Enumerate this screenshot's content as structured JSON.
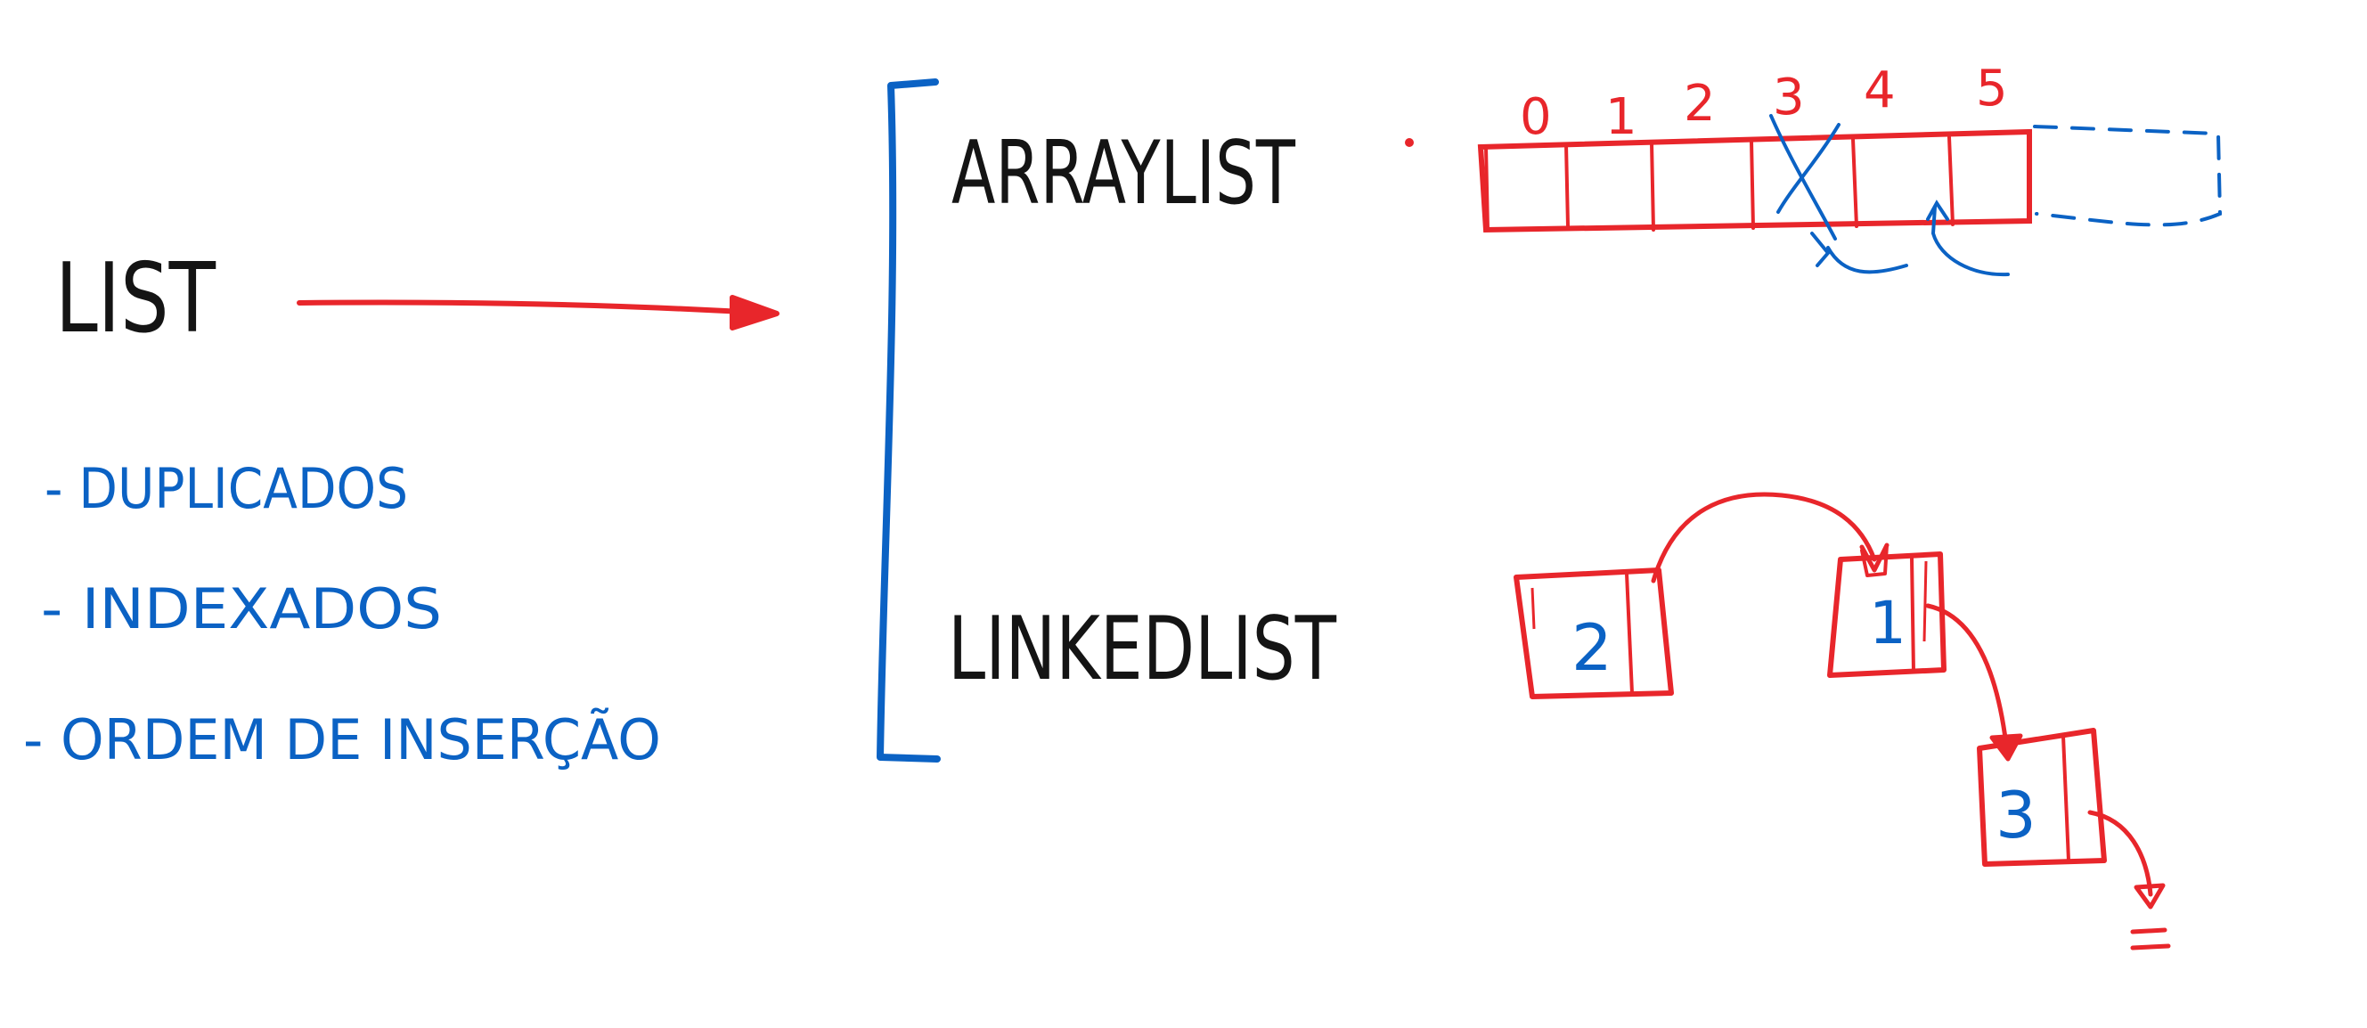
{
  "colors": {
    "black": "#141414",
    "red": "#e8262b",
    "blue": "#0b62c4"
  },
  "list_title": "LIST",
  "features": [
    "- DUPLICADOS",
    "- INDEXADOS",
    "- ORDEM DE INSERÇÃO"
  ],
  "arraylist": {
    "title": "ARRAYLIST",
    "indices": [
      "0",
      "1",
      "2",
      "3",
      "4",
      "5"
    ]
  },
  "linkedlist": {
    "title": "LINKEDLIST",
    "nodes": [
      "2",
      "1",
      "3"
    ]
  }
}
